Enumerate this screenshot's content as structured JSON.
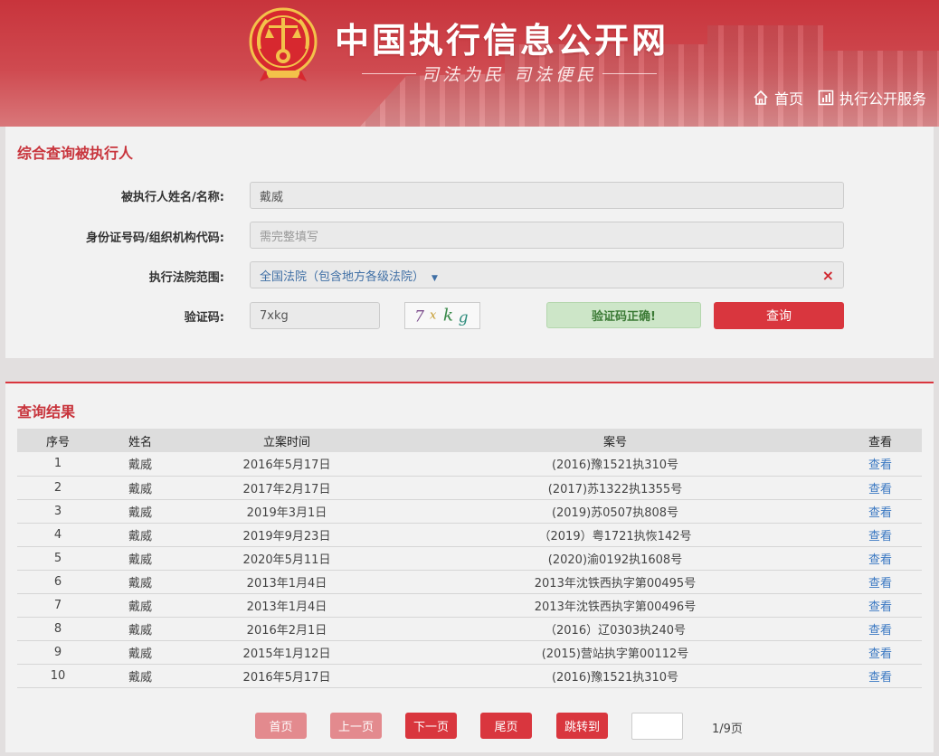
{
  "header": {
    "site_title": "中国执行信息公开网",
    "slogan": "司法为民  司法便民",
    "nav": [
      {
        "label": "首页",
        "icon": "home-icon"
      },
      {
        "label": "执行公开服务",
        "icon": "chart-icon"
      }
    ]
  },
  "search": {
    "title": "综合查询被执行人",
    "name_label": "被执行人姓名/名称:",
    "name_value": "戴威",
    "id_label": "身份证号码/组织机构代码:",
    "id_placeholder": "需完整填写",
    "court_label": "执行法院范围:",
    "court_value": "全国法院（包含地方各级法院）",
    "captcha_label": "验证码:",
    "captcha_value": "7xkg",
    "captcha_chars": [
      "7",
      "x",
      "k",
      "g"
    ],
    "captcha_ok": "验证码正确!",
    "query_button": "查询"
  },
  "results": {
    "title": "查询结果",
    "columns": [
      "序号",
      "姓名",
      "立案时间",
      "案号",
      "查看"
    ],
    "rows": [
      {
        "no": "1",
        "name": "戴威",
        "date": "2016年5月17日",
        "case": "(2016)豫1521执310号",
        "view": "查看"
      },
      {
        "no": "2",
        "name": "戴威",
        "date": "2017年2月17日",
        "case": "(2017)苏1322执1355号",
        "view": "查看"
      },
      {
        "no": "3",
        "name": "戴威",
        "date": "2019年3月1日",
        "case": "(2019)苏0507执808号",
        "view": "查看"
      },
      {
        "no": "4",
        "name": "戴威",
        "date": "2019年9月23日",
        "case": "（2019）粤1721执恢142号",
        "view": "查看"
      },
      {
        "no": "5",
        "name": "戴威",
        "date": "2020年5月11日",
        "case": "(2020)渝0192执1608号",
        "view": "查看"
      },
      {
        "no": "6",
        "name": "戴威",
        "date": "2013年1月4日",
        "case": "2013年沈铁西执字第00495号",
        "view": "查看"
      },
      {
        "no": "7",
        "name": "戴威",
        "date": "2013年1月4日",
        "case": "2013年沈铁西执字第00496号",
        "view": "查看"
      },
      {
        "no": "8",
        "name": "戴威",
        "date": "2016年2月1日",
        "case": "（2016）辽0303执240号",
        "view": "查看"
      },
      {
        "no": "9",
        "name": "戴威",
        "date": "2015年1月12日",
        "case": "(2015)营站执字第00112号",
        "view": "查看"
      },
      {
        "no": "10",
        "name": "戴威",
        "date": "2016年5月17日",
        "case": "(2016)豫1521执310号",
        "view": "查看"
      }
    ]
  },
  "pagination": {
    "first": "首页",
    "prev": "上一页",
    "next": "下一页",
    "last": "尾页",
    "jump": "跳转到",
    "page_info": "1/9页"
  },
  "colors": {
    "brand_red": "#c8343c",
    "button_red": "#d9363e",
    "link_blue": "#3a78c2",
    "success_green": "#cde6c8"
  }
}
